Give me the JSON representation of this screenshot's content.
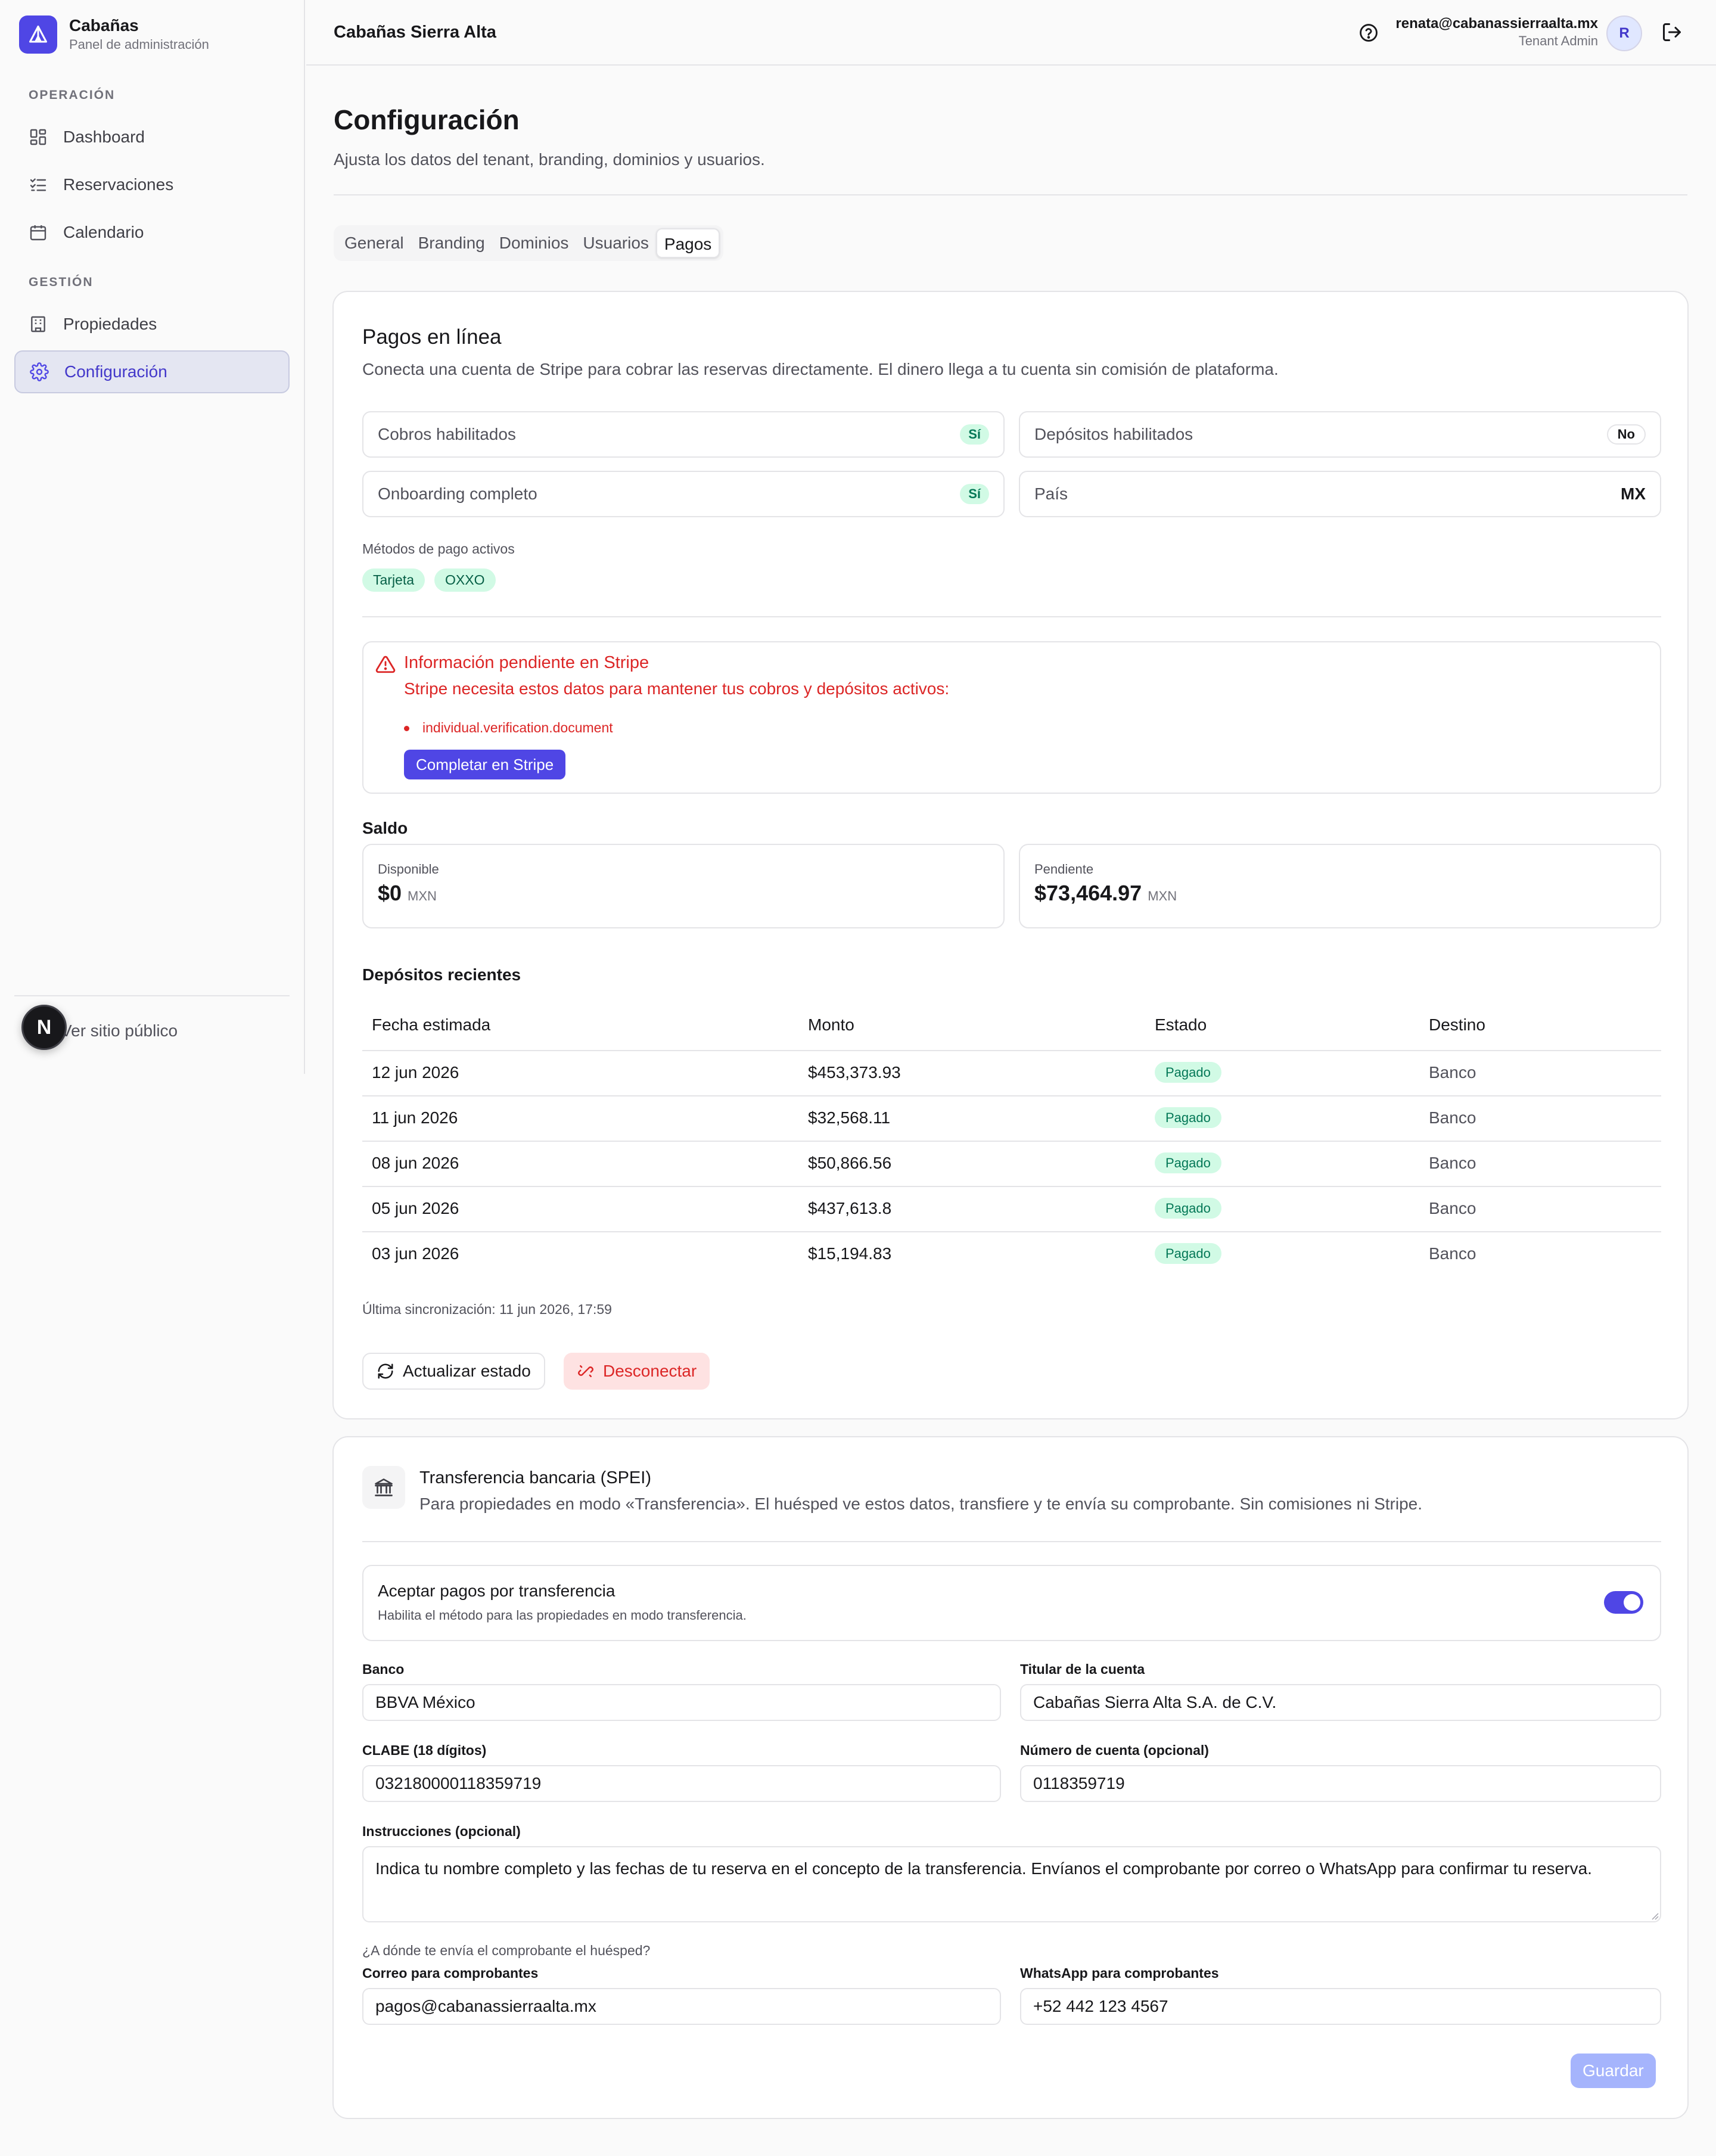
{
  "sidebar": {
    "brand_title": "Cabañas",
    "brand_sub": "Panel de administración",
    "section_ops": "OPERACIÓN",
    "section_mgmt": "GESTIÓN",
    "items": [
      {
        "label": "Dashboard",
        "icon": "grid-icon"
      },
      {
        "label": "Reservaciones",
        "icon": "list-check-icon"
      },
      {
        "label": "Calendario",
        "icon": "calendar-icon"
      },
      {
        "label": "Propiedades",
        "icon": "building-icon"
      },
      {
        "label": "Configuración",
        "icon": "gear-icon",
        "active": true
      }
    ],
    "public_link": "Ver sitio público",
    "n_badge": "N"
  },
  "topbar": {
    "title": "Cabañas Sierra Alta",
    "email": "renata@cabanassierraalta.mx",
    "role": "Tenant Admin",
    "avatar": "R"
  },
  "page": {
    "title": "Configuración",
    "subtitle": "Ajusta los datos del tenant, branding, dominios y usuarios."
  },
  "tabs": [
    "General",
    "Branding",
    "Dominios",
    "Usuarios",
    "Pagos"
  ],
  "active_tab": "Pagos",
  "payments": {
    "title": "Pagos en línea",
    "desc": "Conecta una cuenta de Stripe para cobrar las reservas directamente. El dinero llega a tu cuenta sin comisión de plataforma.",
    "fields": {
      "charges": {
        "label": "Cobros habilitados",
        "value": "Sí"
      },
      "payouts": {
        "label": "Depósitos habilitados",
        "value": "No"
      },
      "onboarding": {
        "label": "Onboarding completo",
        "value": "Sí"
      },
      "country": {
        "label": "País",
        "value": "MX"
      }
    },
    "methods_label": "Métodos de pago activos",
    "methods": [
      "Tarjeta",
      "OXXO"
    ],
    "alert": {
      "title": "Información pendiente en Stripe",
      "desc": "Stripe necesita estos datos para mantener tus cobros y depósitos activos:",
      "item": "individual.verification.document",
      "button": "Completar en Stripe"
    },
    "balance_title": "Saldo",
    "balance": {
      "available_label": "Disponible",
      "available_value": "$0",
      "available_currency": "MXN",
      "pending_label": "Pendiente",
      "pending_value": "$73,464.97",
      "pending_currency": "MXN"
    },
    "deposits_title": "Depósitos recientes",
    "table": {
      "headers": [
        "Fecha estimada",
        "Monto",
        "Estado",
        "Destino"
      ],
      "rows": [
        {
          "date": "12 jun 2026",
          "amount": "$453,373.93",
          "status": "Pagado",
          "dest": "Banco"
        },
        {
          "date": "11 jun 2026",
          "amount": "$32,568.11",
          "status": "Pagado",
          "dest": "Banco"
        },
        {
          "date": "08 jun 2026",
          "amount": "$50,866.56",
          "status": "Pagado",
          "dest": "Banco"
        },
        {
          "date": "05 jun 2026",
          "amount": "$437,613.8",
          "status": "Pagado",
          "dest": "Banco"
        },
        {
          "date": "03 jun 2026",
          "amount": "$15,194.83",
          "status": "Pagado",
          "dest": "Banco"
        }
      ]
    },
    "last_sync": "Última sincronización: 11 jun 2026, 17:59",
    "refresh_button": "Actualizar estado",
    "disconnect_button": "Desconectar"
  },
  "spei": {
    "title": "Transferencia bancaria (SPEI)",
    "desc": "Para propiedades en modo «Transferencia». El huésped ve estos datos, transfiere y te envía su comprobante. Sin comisiones ni Stripe.",
    "toggle_title": "Aceptar pagos por transferencia",
    "toggle_desc": "Habilita el método para las propiedades en modo transferencia.",
    "toggle_on": true,
    "bank_label": "Banco",
    "bank_value": "BBVA México",
    "holder_label": "Titular de la cuenta",
    "holder_value": "Cabañas Sierra Alta S.A. de C.V.",
    "clabe_label": "CLABE (18 dígitos)",
    "clabe_value": "032180000118359719",
    "account_label": "Número de cuenta (opcional)",
    "account_value": "0118359719",
    "instructions_label": "Instrucciones (opcional)",
    "instructions_value": "Indica tu nombre completo y las fechas de tu reserva en el concepto de la transferencia. Envíanos el comprobante por correo o WhatsApp para confirmar tu reserva.",
    "receipt_question": "¿A dónde te envía el comprobante el huésped?",
    "email_label": "Correo para comprobantes",
    "email_value": "pagos@cabanassierraalta.mx",
    "whatsapp_label": "WhatsApp para comprobantes",
    "whatsapp_value": "+52 442 123 4567",
    "save_button": "Guardar"
  },
  "colors": {
    "accent": "#4f46e5",
    "success_bg": "#d1fae5",
    "success_fg": "#047857",
    "danger": "#dc2626",
    "danger_bg": "#fee2e2"
  }
}
